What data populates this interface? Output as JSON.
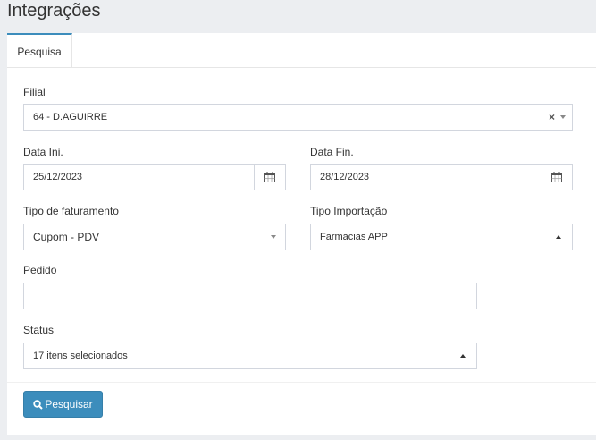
{
  "page": {
    "title": "Integrações"
  },
  "tabs": [
    {
      "label": "Pesquisa",
      "active": true
    }
  ],
  "form": {
    "filial": {
      "label": "Filial",
      "value": "64 - D.AGUIRRE",
      "clear_symbol": "×"
    },
    "data_ini": {
      "label": "Data Ini.",
      "value": "25/12/2023",
      "icon": "calendar-icon"
    },
    "data_fin": {
      "label": "Data Fin.",
      "value": "28/12/2023",
      "icon": "calendar-icon"
    },
    "tipo_faturamento": {
      "label": "Tipo de faturamento",
      "value": "Cupom - PDV"
    },
    "tipo_importacao": {
      "label": "Tipo Importação",
      "value": "Farmacias APP"
    },
    "pedido": {
      "label": "Pedido",
      "value": ""
    },
    "status": {
      "label": "Status",
      "value": "17 itens selecionados"
    }
  },
  "actions": {
    "search_label": "Pesquisar",
    "search_icon": "search-icon"
  },
  "colors": {
    "primary": "#3c8dbc",
    "background": "#eceef1",
    "border": "#d2d6de"
  }
}
